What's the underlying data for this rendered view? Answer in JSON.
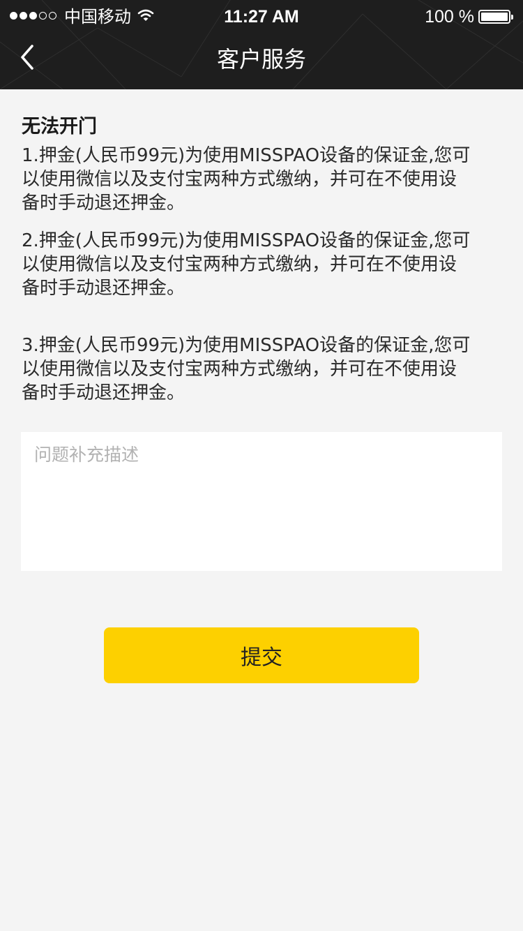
{
  "status_bar": {
    "carrier": "中国移动",
    "time": "11:27 AM",
    "battery": "100 %",
    "signal_strength_filled": 3,
    "signal_strength_total": 5
  },
  "nav": {
    "back_icon": "chevron-left-icon",
    "title": "客户服务"
  },
  "content": {
    "heading": "无法开门",
    "paragraphs": [
      "1.押金(人民币99元)为使用MISSPAO设备的保证金,您可\n以使用微信以及支付宝两种方式缴纳，并可在不使用设\n备时手动退还押金。",
      "2.押金(人民币99元)为使用MISSPAO设备的保证金,您可\n以使用微信以及支付宝两种方式缴纳，并可在不使用设\n备时手动退还押金。",
      "3.押金(人民币99元)为使用MISSPAO设备的保证金,您可\n以使用微信以及支付宝两种方式缴纳，并可在不使用设\n备时手动退还押金。"
    ]
  },
  "form": {
    "description_value": "",
    "description_placeholder": "问题补充描述",
    "submit_label": "提交"
  },
  "colors": {
    "nav_background": "#1e1e1e",
    "page_background": "#f4f4f4",
    "accent_button": "#fdd000",
    "placeholder_text": "#b2b2b2"
  }
}
